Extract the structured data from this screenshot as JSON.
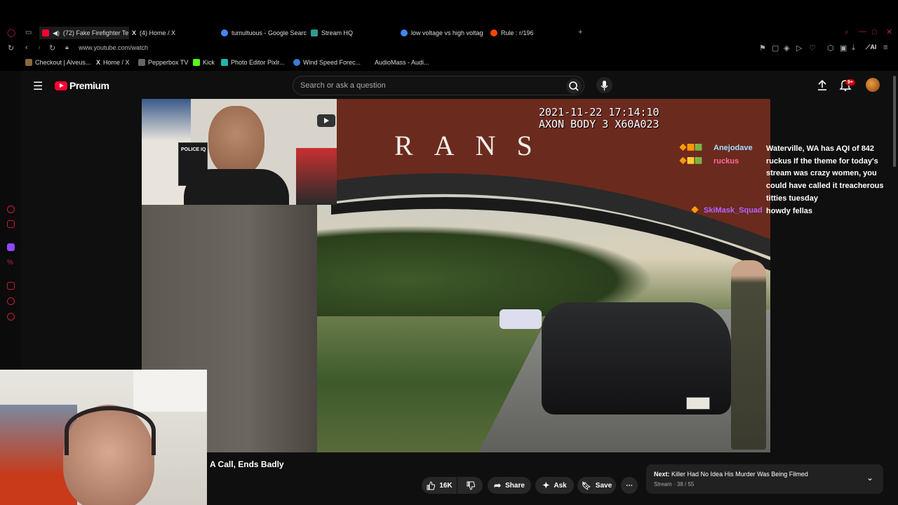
{
  "browser": {
    "tabs": [
      {
        "label": "(72) Fake Firefighter Te",
        "icon": "youtube-icon",
        "active": true
      },
      {
        "label": "(4) Home / X",
        "icon": "x-icon"
      },
      {
        "label": "tumultuous - Google Searc",
        "icon": "google-icon"
      },
      {
        "label": "Stream HQ",
        "icon": "stream-icon"
      },
      {
        "label": "low voltage vs high voltage",
        "icon": "google-icon"
      },
      {
        "label": "Rule : r/196",
        "icon": "reddit-icon"
      }
    ],
    "url": "www.youtube.com/watch",
    "bookmarks": [
      {
        "label": "Checkout | Alveus..."
      },
      {
        "label": "Home / X"
      },
      {
        "label": "Pepperbox TV"
      },
      {
        "label": "Kick"
      },
      {
        "label": "Photo Editor Pixlr..."
      },
      {
        "label": "Wind Speed Forec..."
      },
      {
        "label": "AudioMass - Audi..."
      }
    ],
    "ai_label": "AI"
  },
  "youtube": {
    "brand": "Premium",
    "search_placeholder": "Search or ask a question",
    "notification_count": "9+"
  },
  "video": {
    "timestamp_line1": "2021-11-22 17:14:10",
    "timestamp_line2": "AXON BODY 3 X60A023",
    "sign_text": "RANS",
    "title": "A Call, Ends Badly",
    "webcam_book": "POLICE IQ",
    "like_count": "16K",
    "share_label": "Share",
    "ask_label": "Ask",
    "save_label": "Save"
  },
  "chat": {
    "names": [
      "Anejodave",
      "ruckus",
      "SkiMask_Squad"
    ],
    "messages": [
      "Waterville, WA has AQI of 842",
      "ruckus If the theme for today's",
      "stream was crazy women, you",
      "could have called it treacherous",
      "titties tuesday",
      "howdy fellas"
    ]
  },
  "next": {
    "prefix": "Next:",
    "title": "Killer Had No Idea His Murder Was Being Filmed",
    "subtitle": "Stream · 38 / 55"
  },
  "colors": {
    "accent": "#ff0033",
    "chat_purple": "#b464ff"
  }
}
